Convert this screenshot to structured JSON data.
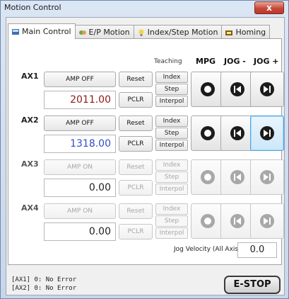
{
  "window": {
    "title": "Motion Control",
    "close": "x"
  },
  "tabs": [
    {
      "label": "Main Control",
      "icon": "main-control-icon",
      "active": true
    },
    {
      "label": "E/P Motion",
      "icon": "ep-motion-icon",
      "active": false
    },
    {
      "label": "Index/Step Motion",
      "icon": "lightbulb-icon",
      "active": false
    },
    {
      "label": "Homing",
      "icon": "homing-icon",
      "active": false
    }
  ],
  "headers": {
    "teaching": "Teaching",
    "mpg": "MPG",
    "jog_minus": "JOG -",
    "jog_plus": "JOG +"
  },
  "axes": [
    {
      "label": "AX1",
      "amp": "AMP OFF",
      "reset": "Reset",
      "value": "2011.00",
      "pclr": "PCLR",
      "index": "Index",
      "step": "Step",
      "interpol": "Interpol",
      "enabled": true
    },
    {
      "label": "AX2",
      "amp": "AMP OFF",
      "reset": "Reset",
      "value": "1318.00",
      "pclr": "PCLR",
      "index": "Index",
      "step": "Step",
      "interpol": "Interpol",
      "enabled": true
    },
    {
      "label": "AX3",
      "amp": "AMP ON",
      "reset": "Reset",
      "value": "0.00",
      "pclr": "PCLR",
      "index": "Index",
      "step": "Step",
      "interpol": "Interpol",
      "enabled": false
    },
    {
      "label": "AX4",
      "amp": "AMP ON",
      "reset": "Reset",
      "value": "0.00",
      "pclr": "PCLR",
      "index": "Index",
      "step": "Step",
      "interpol": "Interpol",
      "enabled": false
    }
  ],
  "jog": {
    "label": "Jog Velocity (All Axis)",
    "value": "0.0"
  },
  "status": {
    "line1": "[AX1] 0: No Error",
    "line2": "[AX2] 0: No Error"
  },
  "estop": "E-STOP",
  "colors": {
    "ax1_value": "#8b1a1a",
    "ax2_value": "#2d4fc7"
  }
}
